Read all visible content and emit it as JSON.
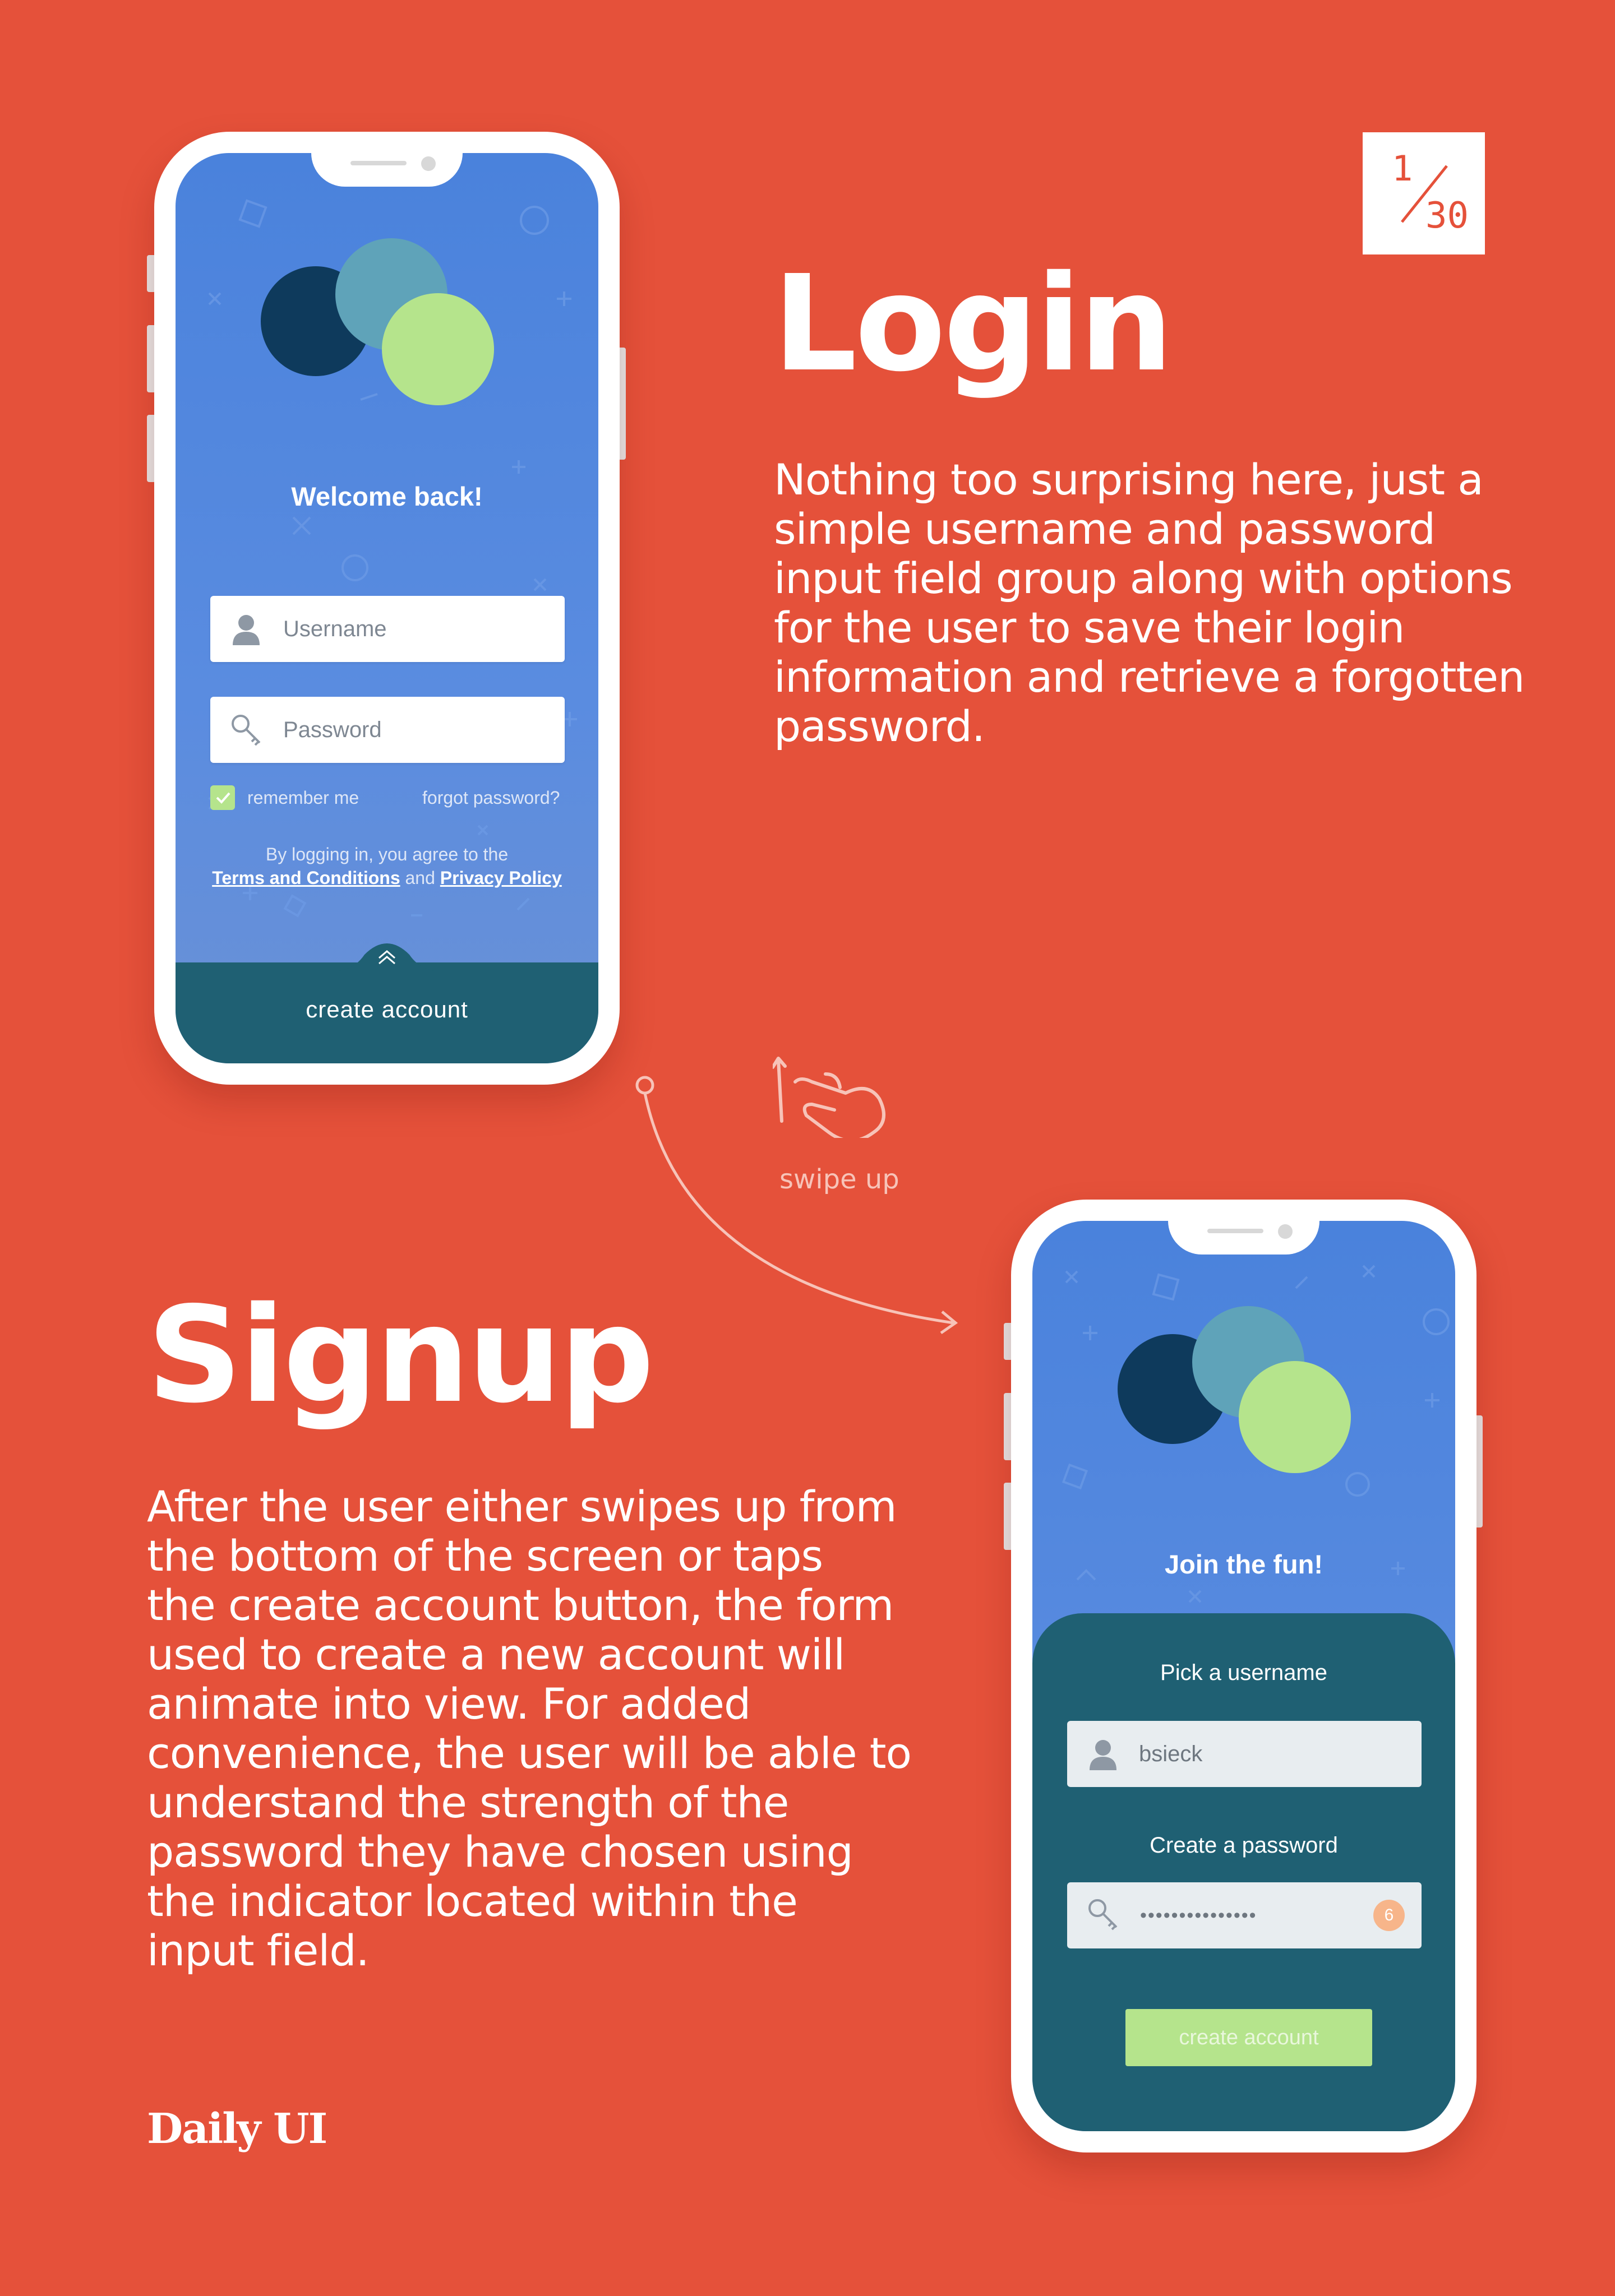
{
  "badge": {
    "current": "1",
    "total": "30"
  },
  "login": {
    "heading": "Login",
    "description_lines": [
      "Nothing too surprising here, just a",
      "simple username and password",
      "input field group along with options",
      "for the user to save their login",
      "information and retrieve a forgotten",
      "password."
    ]
  },
  "signup": {
    "heading": "Signup",
    "description_lines": [
      "After the user either swipes up from",
      "the bottom of the screen or taps",
      "the create account button, the form",
      "used to create a new account will",
      "animate into view. For added",
      "convenience, the user will be able to",
      "understand the strength of the",
      "password they have chosen using",
      "the indicator located within the",
      "input field."
    ]
  },
  "login_screen": {
    "welcome": "Welcome back!",
    "username_placeholder": "Username",
    "password_placeholder": "Password",
    "remember_me": "remember me",
    "forgot_password": "forgot password?",
    "terms_prefix": "By logging in, you agree to the",
    "terms_link": "Terms and Conditions",
    "terms_and": "and",
    "privacy_link": "Privacy Policy",
    "create_account": "create account"
  },
  "signup_screen": {
    "title": "Join the fun!",
    "username_label": "Pick a username",
    "username_value": "bsieck",
    "password_label": "Create a password",
    "password_value": "•••••••••••••••",
    "strength": "6",
    "create_account": "create account"
  },
  "swipe": {
    "label": "swipe up"
  },
  "brand": {
    "name": "Daily UI"
  },
  "colors": {
    "background": "#E5513A",
    "screen_blue": "#4A82DC",
    "teal": "#1F6073",
    "navy_circle": "#0E3A5C",
    "mid_circle": "#5FA3B9",
    "green": "#B5E48C",
    "strength_orange": "#F7B58A"
  }
}
